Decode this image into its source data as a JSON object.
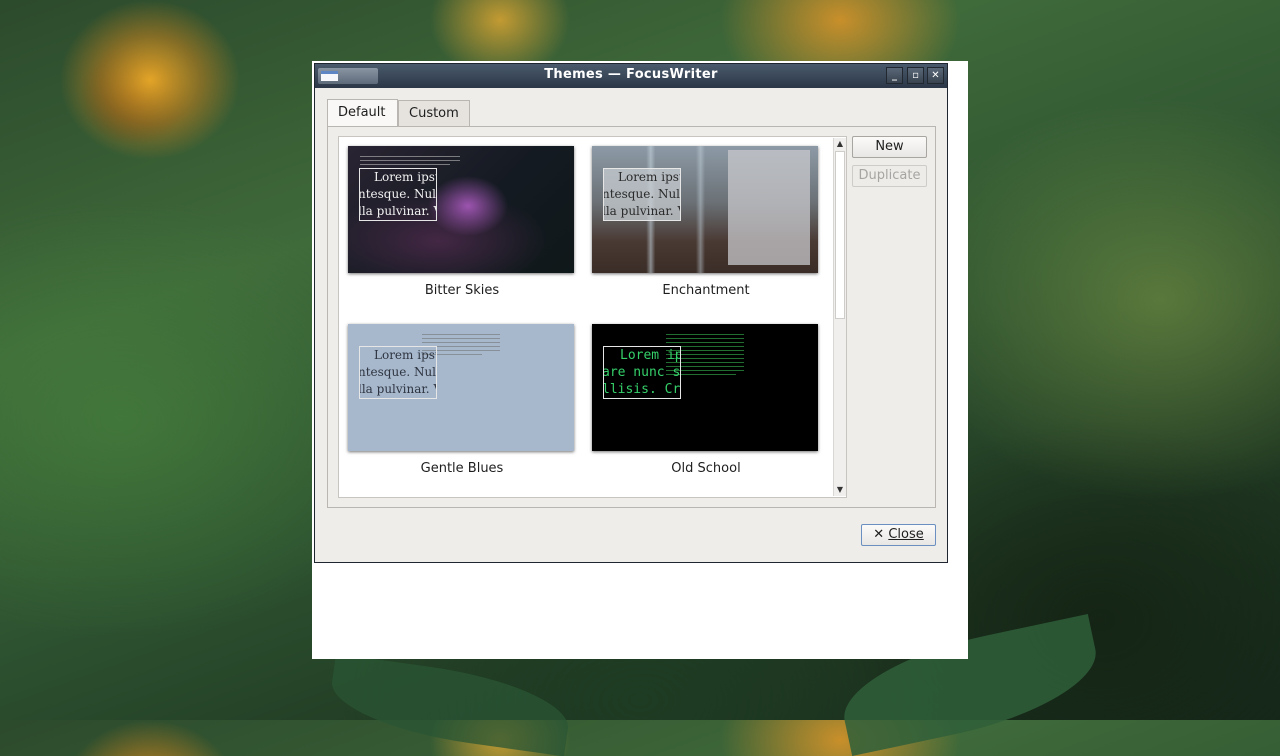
{
  "window": {
    "title": "Themes — FocusWriter",
    "controls": [
      "minimize",
      "maximize",
      "close"
    ]
  },
  "tabs": [
    {
      "label": "Default",
      "active": true
    },
    {
      "label": "Custom",
      "active": false
    }
  ],
  "themes": [
    {
      "name": "Bitter Skies",
      "preview_lines": [
        "Lorem ipsu",
        "ntesque. Nulla",
        "lla pulvinar. V"
      ]
    },
    {
      "name": "Enchantment",
      "preview_lines": [
        "Lorem ipsu",
        "ntesque. Nulla",
        "lla pulvinar. V"
      ]
    },
    {
      "name": "Gentle Blues",
      "preview_lines": [
        "Lorem ipsu",
        "ntesque. Nulla",
        "lla pulvinar. V"
      ]
    },
    {
      "name": "Old School",
      "preview_lines": [
        "Lorem ip",
        "are nunc s",
        "llisis. Cr"
      ]
    }
  ],
  "buttons": {
    "new": "New",
    "duplicate": "Duplicate",
    "close": "Close"
  },
  "colors": {
    "titlebar": "#2b3747",
    "dialog_bg": "#efedea",
    "old_school_text": "#35d06a",
    "gentle_blues_bg": "#a7b8cd"
  }
}
